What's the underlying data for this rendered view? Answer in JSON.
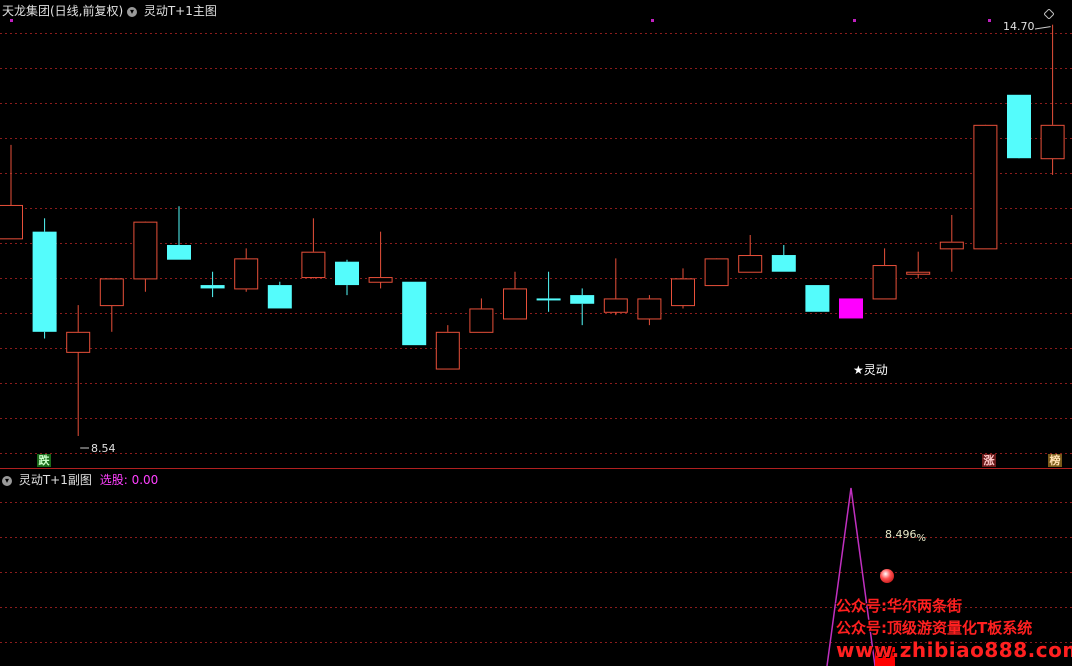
{
  "header": {
    "main_title": "天龙集团(日线,前复权)",
    "indicator_main": "灵动T+1主图",
    "indicator_sub": "灵动T+1副图",
    "sub_label": "选股:",
    "sub_value": "0.00"
  },
  "annotations": {
    "high_price": "14.70",
    "low_price": "8.54",
    "signal_label": "★灵动",
    "percent_text": "8.496",
    "percent_symbol": "%"
  },
  "tags": {
    "down": "跌",
    "up": "涨",
    "rank": "榜"
  },
  "watermarks": {
    "line1": "公众号:华尔两条街",
    "line2": "公众号:顶级游资量化T板系统",
    "line3": "www.zhibiao888.com"
  },
  "colors": {
    "up_candle": "#e8503a",
    "down_candle": "#54fcfc",
    "signal_candle": "#ff00ff",
    "grid": "#8a1c1c",
    "divider": "#b02020",
    "sub_line": "#c030c0",
    "sub_bar": "#ff0000",
    "watermark": "#ff2020"
  },
  "candles": [
    {
      "o": 12.0,
      "h": 12.9,
      "l": 11.5,
      "c": 11.5,
      "type": "up"
    },
    {
      "o": 11.6,
      "h": 11.8,
      "l": 10.0,
      "c": 10.1,
      "type": "down"
    },
    {
      "o": 9.8,
      "h": 10.5,
      "l": 8.54,
      "c": 10.1,
      "type": "up"
    },
    {
      "o": 10.5,
      "h": 10.65,
      "l": 10.1,
      "c": 10.9,
      "type": "up"
    },
    {
      "o": 10.9,
      "h": 11.2,
      "l": 10.7,
      "c": 11.75,
      "type": "up"
    },
    {
      "o": 11.4,
      "h": 11.98,
      "l": 11.18,
      "c": 11.18,
      "type": "down"
    },
    {
      "o": 10.8,
      "h": 11.0,
      "l": 10.62,
      "c": 10.75,
      "type": "down"
    },
    {
      "o": 10.75,
      "h": 11.35,
      "l": 10.7,
      "c": 11.2,
      "type": "up"
    },
    {
      "o": 10.8,
      "h": 10.85,
      "l": 10.45,
      "c": 10.45,
      "type": "down"
    },
    {
      "o": 11.3,
      "h": 11.8,
      "l": 10.9,
      "c": 10.92,
      "type": "up"
    },
    {
      "o": 11.15,
      "h": 11.18,
      "l": 10.65,
      "c": 10.8,
      "type": "down"
    },
    {
      "o": 10.85,
      "h": 11.6,
      "l": 10.75,
      "c": 10.92,
      "type": "up"
    },
    {
      "o": 10.85,
      "h": 10.85,
      "l": 9.9,
      "c": 9.9,
      "type": "down"
    },
    {
      "o": 9.55,
      "h": 10.2,
      "l": 9.55,
      "c": 10.1,
      "type": "up"
    },
    {
      "o": 10.1,
      "h": 10.6,
      "l": 10.1,
      "c": 10.45,
      "type": "up"
    },
    {
      "o": 10.3,
      "h": 11.0,
      "l": 10.3,
      "c": 10.75,
      "type": "up"
    },
    {
      "o": 10.6,
      "h": 11.0,
      "l": 10.4,
      "c": 10.6,
      "type": "down"
    },
    {
      "o": 10.65,
      "h": 10.75,
      "l": 10.2,
      "c": 10.52,
      "type": "down"
    },
    {
      "o": 10.4,
      "h": 11.2,
      "l": 10.35,
      "c": 10.6,
      "type": "up"
    },
    {
      "o": 10.3,
      "h": 10.65,
      "l": 10.2,
      "c": 10.6,
      "type": "up"
    },
    {
      "o": 10.5,
      "h": 11.05,
      "l": 10.45,
      "c": 10.9,
      "type": "up"
    },
    {
      "o": 10.8,
      "h": 11.15,
      "l": 10.8,
      "c": 11.2,
      "type": "up"
    },
    {
      "o": 11.0,
      "h": 11.55,
      "l": 11.0,
      "c": 11.25,
      "type": "up"
    },
    {
      "o": 11.25,
      "h": 11.4,
      "l": 11.0,
      "c": 11.0,
      "type": "down"
    },
    {
      "o": 10.8,
      "h": 10.8,
      "l": 10.4,
      "c": 10.4,
      "type": "down"
    },
    {
      "o": 10.6,
      "h": 10.6,
      "l": 10.3,
      "c": 10.3,
      "type": "signal"
    },
    {
      "o": 10.6,
      "h": 11.35,
      "l": 10.6,
      "c": 11.1,
      "type": "up"
    },
    {
      "o": 10.98,
      "h": 11.3,
      "l": 10.9,
      "c": 11.0,
      "type": "up"
    },
    {
      "o": 11.35,
      "h": 11.85,
      "l": 11.0,
      "c": 11.45,
      "type": "up"
    },
    {
      "o": 11.35,
      "h": 11.35,
      "l": 11.35,
      "c": 13.2,
      "type": "up"
    },
    {
      "o": 13.65,
      "h": 13.65,
      "l": 12.75,
      "c": 12.7,
      "type": "down"
    },
    {
      "o": 12.7,
      "h": 14.7,
      "l": 12.45,
      "c": 13.2,
      "type": "up"
    }
  ],
  "price_range": [
    8.3,
    14.8
  ],
  "sub_chart": {
    "peak_index": 25
  }
}
